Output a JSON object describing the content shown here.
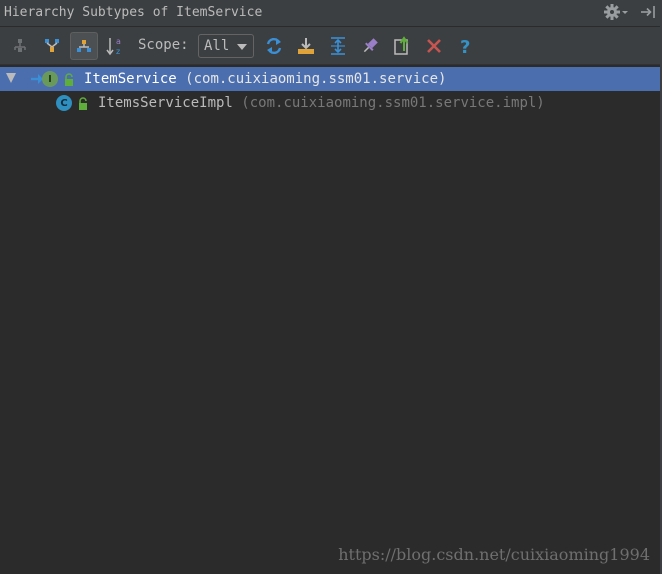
{
  "window": {
    "title": "Hierarchy Subtypes of ItemService"
  },
  "title_actions": [
    {
      "name": "settings-gear-icon",
      "icon": "gear"
    },
    {
      "name": "hide-panel-icon",
      "icon": "hide-right"
    }
  ],
  "toolbar": {
    "buttons": [
      {
        "name": "type-hierarchy-icon",
        "icon": "class-hierarchy",
        "active": false
      },
      {
        "name": "supertypes-hierarchy-icon",
        "icon": "supertypes",
        "active": false
      },
      {
        "name": "subtypes-hierarchy-icon",
        "icon": "subtypes",
        "active": true
      },
      {
        "name": "sort-alphabetically-icon",
        "icon": "sort-az",
        "active": false
      },
      {
        "name": "refresh-icon",
        "icon": "refresh",
        "active": false
      },
      {
        "name": "autoscroll-to-source-icon",
        "icon": "autoscroll-to",
        "active": false
      },
      {
        "name": "expand-all-icon",
        "icon": "expand-all",
        "active": false
      },
      {
        "name": "pin-icon",
        "icon": "pin",
        "active": false
      },
      {
        "name": "export-icon",
        "icon": "export",
        "active": false
      },
      {
        "name": "close-icon",
        "icon": "close",
        "active": false
      },
      {
        "name": "help-icon",
        "icon": "help",
        "active": false
      }
    ],
    "scope_label": "Scope:",
    "scope_value": "All"
  },
  "tree": {
    "items": [
      {
        "name": "ItemService",
        "package": "(com.cuixiaoming.ssm01.service)",
        "kind": "interface",
        "badge": "I",
        "expanded": true,
        "selected": true
      },
      {
        "name": "ItemsServiceImpl",
        "package": "(com.cuixiaoming.ssm01.service.impl)",
        "kind": "class",
        "badge": "C",
        "expanded": false,
        "selected": false
      }
    ]
  },
  "watermark": "https://blog.csdn.net/cuixiaoming1994",
  "colors": {
    "panel_bg": "#2b2b2b",
    "toolbar_bg": "#3c3f41",
    "selection_bg": "#4b6eaf",
    "interface_badge": "#6a9a5b",
    "class_badge": "#2f8fbf",
    "close_red": "#c75450",
    "help_blue": "#3592c4",
    "refresh_blue": "#3a8fd6",
    "orange": "#e0a33a"
  }
}
